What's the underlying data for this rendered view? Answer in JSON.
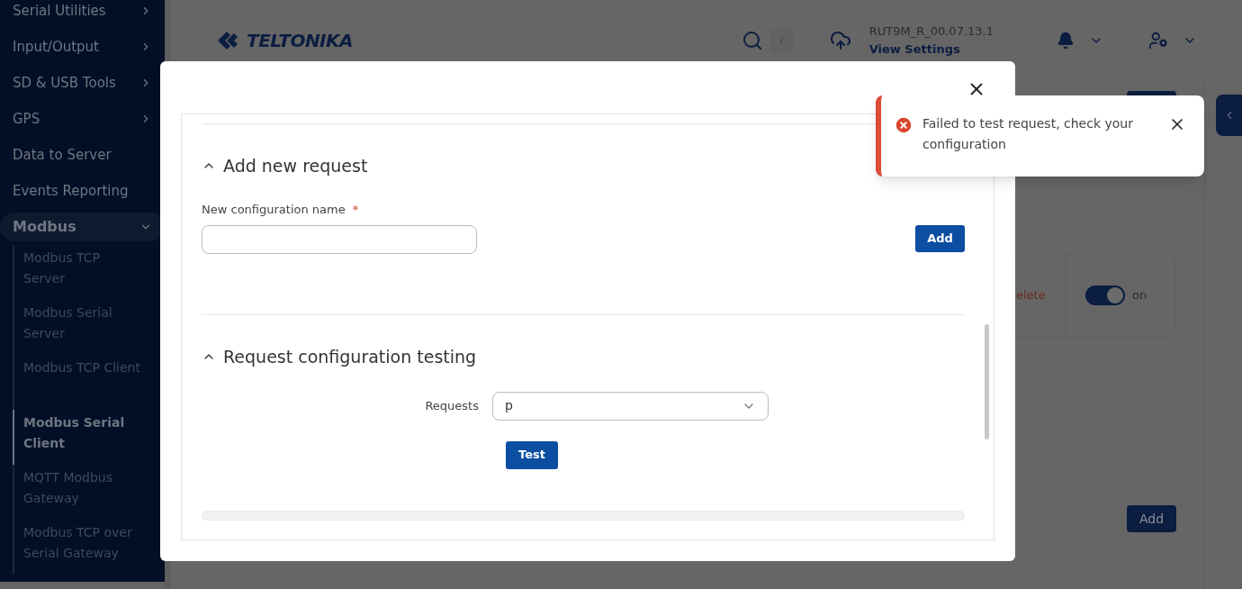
{
  "sidebar": {
    "items": [
      {
        "label": "Serial Utilities",
        "kind": "menu"
      },
      {
        "label": "Input/Output",
        "kind": "menu"
      },
      {
        "label": "SD & USB Tools",
        "kind": "menu"
      },
      {
        "label": "GPS",
        "kind": "menu"
      },
      {
        "label": "Data to Server",
        "kind": "link"
      },
      {
        "label": "Events Reporting",
        "kind": "link"
      },
      {
        "label": "Modbus",
        "kind": "group",
        "expanded": true,
        "children": [
          {
            "label": "Modbus TCP Server",
            "selected": false
          },
          {
            "label": "Modbus Serial Server",
            "selected": false
          },
          {
            "label": "Modbus TCP Client",
            "selected": false
          },
          {
            "label": "Modbus Serial Client",
            "selected": true
          },
          {
            "label": "MQTT Modbus Gateway",
            "selected": false
          },
          {
            "label": "Modbus TCP over Serial Gateway",
            "selected": false
          }
        ]
      }
    ]
  },
  "header": {
    "logo": "TELTONIKA",
    "search_shortcut": "/",
    "firmware": "RUT9M_R_00.07.13.1",
    "view_settings": "View Settings"
  },
  "background": {
    "delete_link": "elete",
    "toggle": {
      "on": true,
      "label": "on"
    },
    "add_button": "Add"
  },
  "modal": {
    "sections": [
      {
        "title": "Add new request",
        "expanded": true,
        "field_label": "New configuration name",
        "required_mark": "*",
        "button": "Add"
      },
      {
        "title": "Request configuration testing",
        "expanded": true,
        "select_label": "Requests",
        "select_value": "p",
        "button": "Test"
      }
    ]
  },
  "toast": {
    "message": "Failed to test request, check your configuration"
  }
}
